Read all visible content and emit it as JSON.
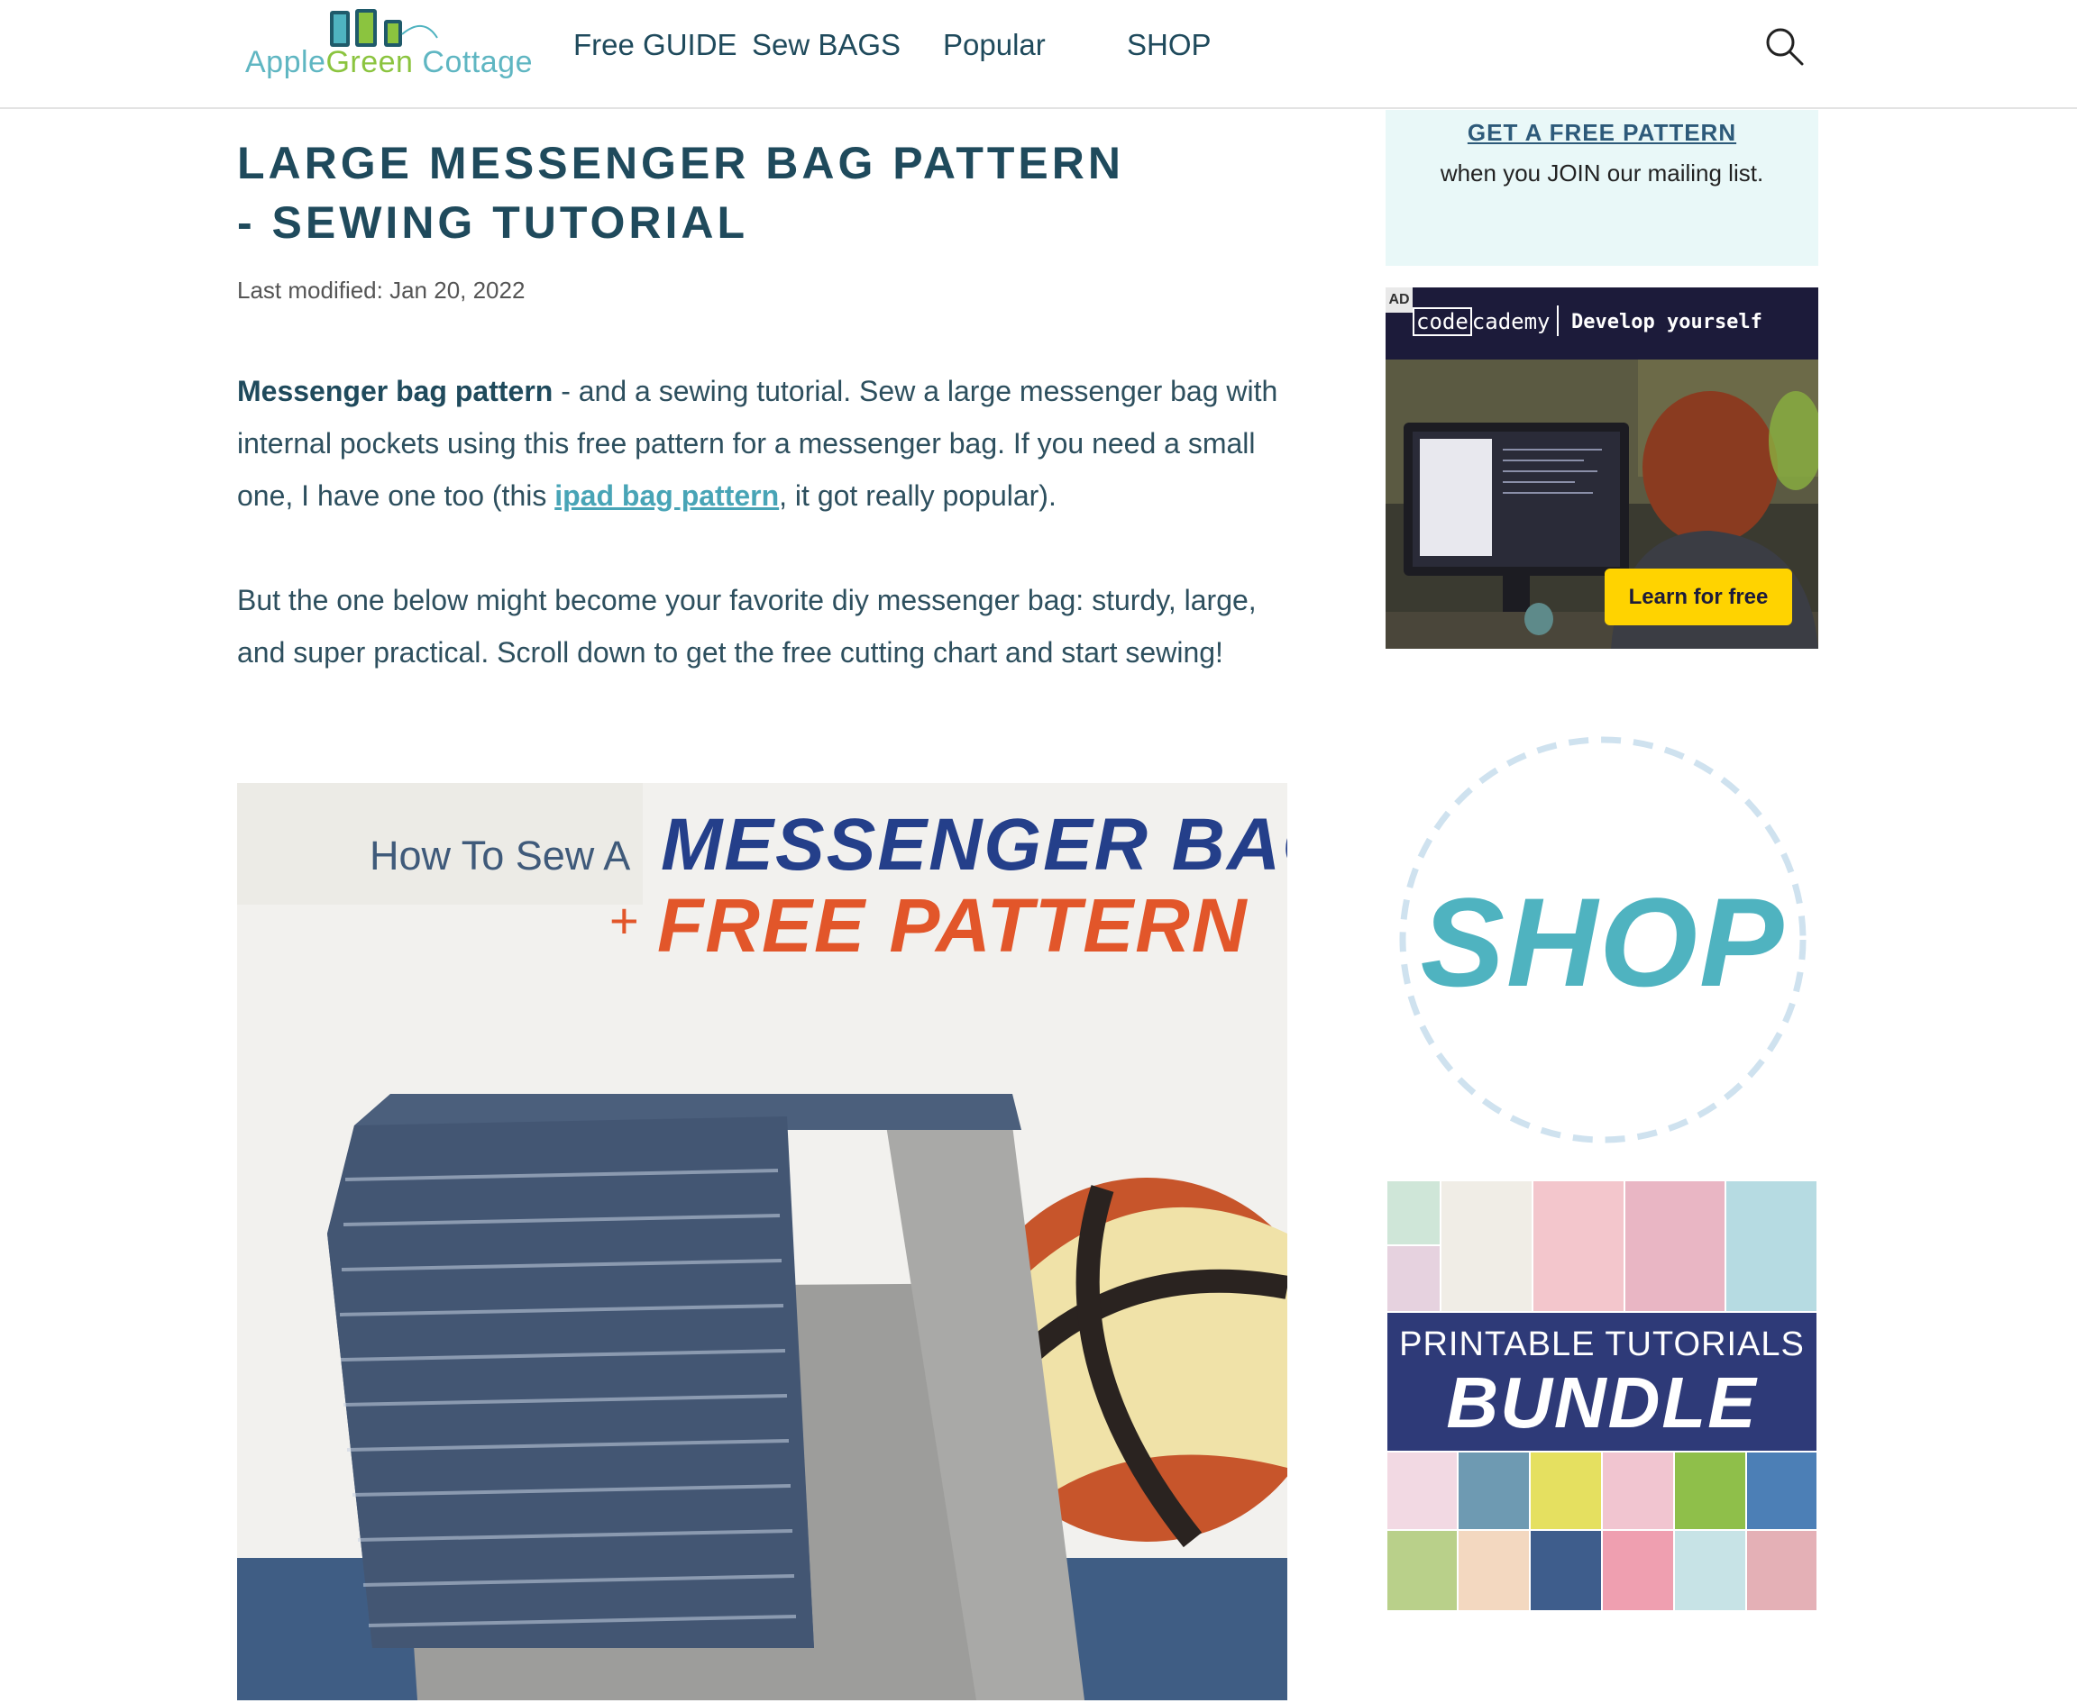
{
  "header": {
    "logo_word_1": "Apple",
    "logo_word_2": "Green",
    "logo_word_3": " Cottage",
    "nav": [
      "Free GUIDE",
      "Sew BAGS",
      "Popular",
      "SHOP"
    ]
  },
  "article": {
    "title": "LARGE MESSENGER BAG PATTERN - SEWING TUTORIAL",
    "last_modified": "Last modified: Jan 20, 2022",
    "intro_bold": "Messenger bag pattern",
    "intro_text_1": " - and a sewing tutorial. Sew a large messenger bag with internal pockets using this free pattern for a messenger bag. If you need a small one, I have one too (this ",
    "intro_link": "ipad bag pattern",
    "intro_text_2": ", it got really popular).",
    "para2": "But the one below might become your favorite diy messenger bag: sturdy, large, and super practical. Scroll down to get the free cutting chart and start sewing!",
    "hero": {
      "how_to": "How To Sew A",
      "headline": "MESSENGER BAG",
      "plus": "+",
      "subheadline": "FREE PATTERN"
    }
  },
  "sidebar": {
    "signup_link": "GET A FREE PATTERN",
    "signup_text": "when you JOIN our mailing list.",
    "ad": {
      "label": "AD",
      "brand_box": "code",
      "brand_rest": "cademy",
      "tagline": "Develop yourself",
      "cta": "Learn for free"
    },
    "shop_badge": "SHOP",
    "bundle": {
      "line1": "PRINTABLE TUTORIALS",
      "line2": "BUNDLE"
    }
  },
  "colors": {
    "brand_navy": "#1f4a5c",
    "link_teal": "#48a4b6",
    "accent_orange": "#e2562a",
    "ad_yellow": "#ffd300"
  }
}
